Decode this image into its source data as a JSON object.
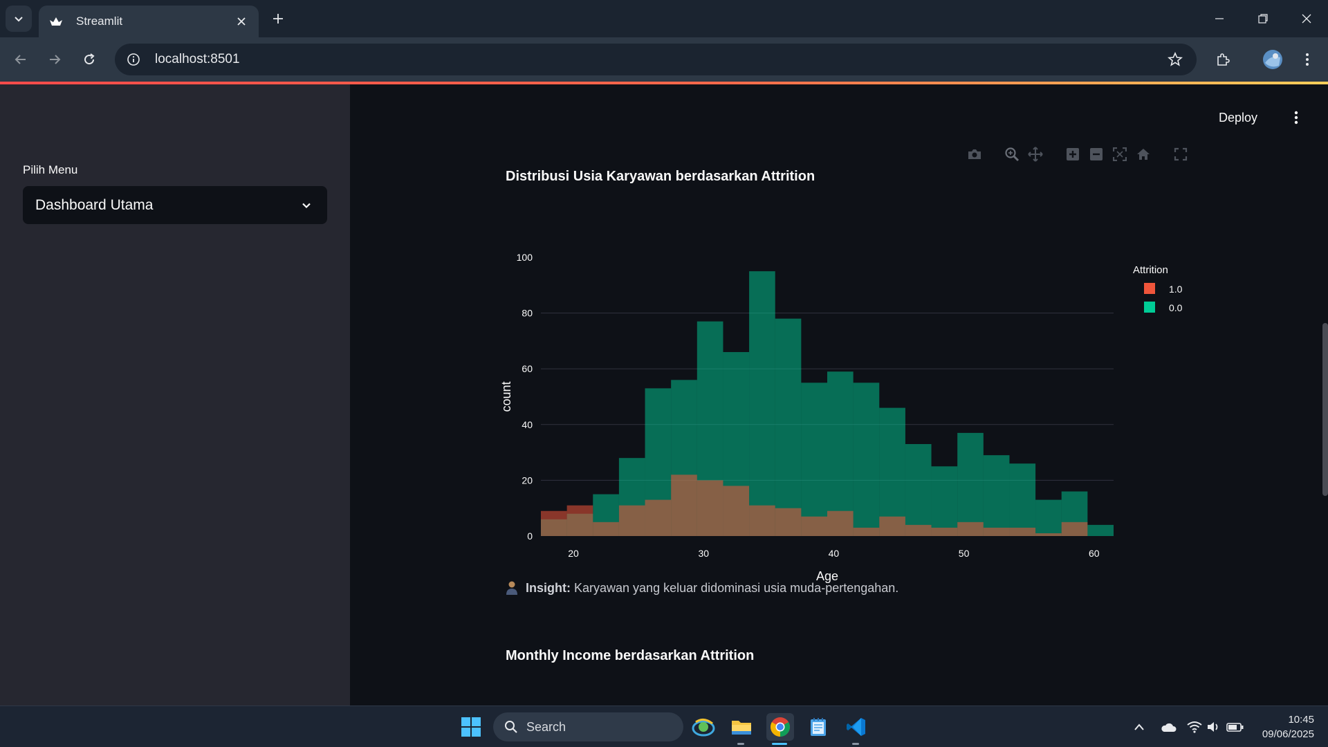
{
  "browser": {
    "tab_title": "Streamlit",
    "url": "localhost:8501"
  },
  "sidebar": {
    "menu_label": "Pilih Menu",
    "menu_selected": "Dashboard Utama"
  },
  "header": {
    "deploy_label": "Deploy"
  },
  "main": {
    "chart_title": "Distribusi Usia Karyawan berdasarkan Attrition",
    "insight_label": "Insight:",
    "insight_text": "Karyawan yang keluar didominasi usia muda-pertengahan.",
    "next_section_title": "Monthly Income berdasarkan Attrition"
  },
  "chart_data": {
    "type": "bar",
    "title": "Distribusi Usia Karyawan berdasarkan Attrition",
    "xlabel": "Age",
    "ylabel": "count",
    "xlim": [
      17.5,
      61.5
    ],
    "ylim": [
      0,
      100
    ],
    "xticks": [
      20,
      30,
      40,
      50,
      60
    ],
    "yticks": [
      0,
      20,
      40,
      60,
      80,
      100
    ],
    "bin_start": 17.5,
    "bin_width": 2,
    "legend_title": "Attrition",
    "legend_position": "top-right",
    "barmode": "overlay",
    "grid": true,
    "series": [
      {
        "name": "1.0",
        "color": "#ef553b",
        "values": [
          9,
          11,
          5,
          11,
          13,
          22,
          20,
          18,
          11,
          10,
          7,
          9,
          3,
          7,
          4,
          3,
          5,
          3,
          3,
          1,
          5,
          0
        ]
      },
      {
        "name": "0.0",
        "color": "#00cc96",
        "values": [
          6,
          8,
          15,
          28,
          53,
          56,
          77,
          66,
          95,
          78,
          55,
          59,
          55,
          46,
          33,
          25,
          37,
          29,
          26,
          13,
          16,
          4
        ]
      }
    ]
  },
  "taskbar": {
    "search_label": "Search",
    "time": "10:45",
    "date": "09/06/2025"
  },
  "colors": {
    "app_bg": "#0e1117",
    "sidebar_bg": "#262730",
    "accent": "#ff4b4b"
  }
}
